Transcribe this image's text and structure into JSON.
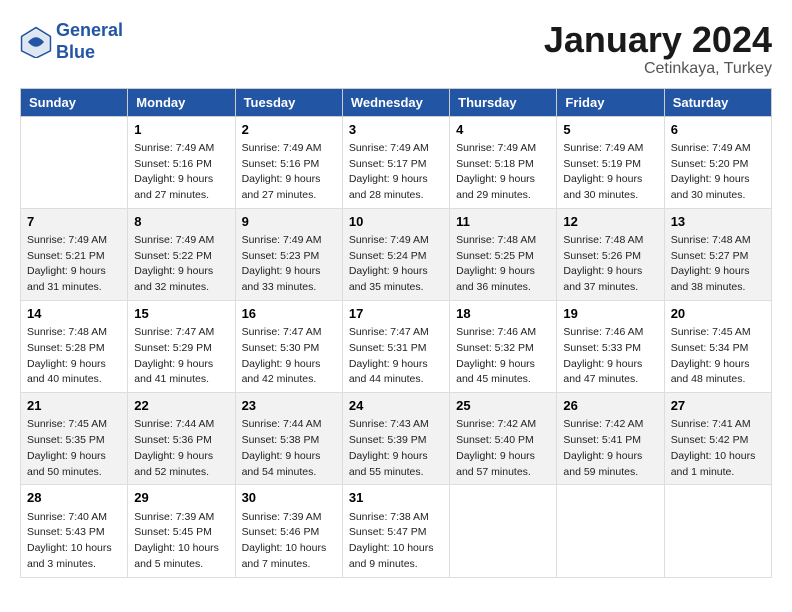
{
  "header": {
    "logo_line1": "General",
    "logo_line2": "Blue",
    "month_title": "January 2024",
    "location": "Cetinkaya, Turkey"
  },
  "days_of_week": [
    "Sunday",
    "Monday",
    "Tuesday",
    "Wednesday",
    "Thursday",
    "Friday",
    "Saturday"
  ],
  "weeks": [
    [
      {
        "day": "",
        "sunrise": "",
        "sunset": "",
        "daylight": ""
      },
      {
        "day": "1",
        "sunrise": "Sunrise: 7:49 AM",
        "sunset": "Sunset: 5:16 PM",
        "daylight": "Daylight: 9 hours and 27 minutes."
      },
      {
        "day": "2",
        "sunrise": "Sunrise: 7:49 AM",
        "sunset": "Sunset: 5:16 PM",
        "daylight": "Daylight: 9 hours and 27 minutes."
      },
      {
        "day": "3",
        "sunrise": "Sunrise: 7:49 AM",
        "sunset": "Sunset: 5:17 PM",
        "daylight": "Daylight: 9 hours and 28 minutes."
      },
      {
        "day": "4",
        "sunrise": "Sunrise: 7:49 AM",
        "sunset": "Sunset: 5:18 PM",
        "daylight": "Daylight: 9 hours and 29 minutes."
      },
      {
        "day": "5",
        "sunrise": "Sunrise: 7:49 AM",
        "sunset": "Sunset: 5:19 PM",
        "daylight": "Daylight: 9 hours and 30 minutes."
      },
      {
        "day": "6",
        "sunrise": "Sunrise: 7:49 AM",
        "sunset": "Sunset: 5:20 PM",
        "daylight": "Daylight: 9 hours and 30 minutes."
      }
    ],
    [
      {
        "day": "7",
        "sunrise": "Sunrise: 7:49 AM",
        "sunset": "Sunset: 5:21 PM",
        "daylight": "Daylight: 9 hours and 31 minutes."
      },
      {
        "day": "8",
        "sunrise": "Sunrise: 7:49 AM",
        "sunset": "Sunset: 5:22 PM",
        "daylight": "Daylight: 9 hours and 32 minutes."
      },
      {
        "day": "9",
        "sunrise": "Sunrise: 7:49 AM",
        "sunset": "Sunset: 5:23 PM",
        "daylight": "Daylight: 9 hours and 33 minutes."
      },
      {
        "day": "10",
        "sunrise": "Sunrise: 7:49 AM",
        "sunset": "Sunset: 5:24 PM",
        "daylight": "Daylight: 9 hours and 35 minutes."
      },
      {
        "day": "11",
        "sunrise": "Sunrise: 7:48 AM",
        "sunset": "Sunset: 5:25 PM",
        "daylight": "Daylight: 9 hours and 36 minutes."
      },
      {
        "day": "12",
        "sunrise": "Sunrise: 7:48 AM",
        "sunset": "Sunset: 5:26 PM",
        "daylight": "Daylight: 9 hours and 37 minutes."
      },
      {
        "day": "13",
        "sunrise": "Sunrise: 7:48 AM",
        "sunset": "Sunset: 5:27 PM",
        "daylight": "Daylight: 9 hours and 38 minutes."
      }
    ],
    [
      {
        "day": "14",
        "sunrise": "Sunrise: 7:48 AM",
        "sunset": "Sunset: 5:28 PM",
        "daylight": "Daylight: 9 hours and 40 minutes."
      },
      {
        "day": "15",
        "sunrise": "Sunrise: 7:47 AM",
        "sunset": "Sunset: 5:29 PM",
        "daylight": "Daylight: 9 hours and 41 minutes."
      },
      {
        "day": "16",
        "sunrise": "Sunrise: 7:47 AM",
        "sunset": "Sunset: 5:30 PM",
        "daylight": "Daylight: 9 hours and 42 minutes."
      },
      {
        "day": "17",
        "sunrise": "Sunrise: 7:47 AM",
        "sunset": "Sunset: 5:31 PM",
        "daylight": "Daylight: 9 hours and 44 minutes."
      },
      {
        "day": "18",
        "sunrise": "Sunrise: 7:46 AM",
        "sunset": "Sunset: 5:32 PM",
        "daylight": "Daylight: 9 hours and 45 minutes."
      },
      {
        "day": "19",
        "sunrise": "Sunrise: 7:46 AM",
        "sunset": "Sunset: 5:33 PM",
        "daylight": "Daylight: 9 hours and 47 minutes."
      },
      {
        "day": "20",
        "sunrise": "Sunrise: 7:45 AM",
        "sunset": "Sunset: 5:34 PM",
        "daylight": "Daylight: 9 hours and 48 minutes."
      }
    ],
    [
      {
        "day": "21",
        "sunrise": "Sunrise: 7:45 AM",
        "sunset": "Sunset: 5:35 PM",
        "daylight": "Daylight: 9 hours and 50 minutes."
      },
      {
        "day": "22",
        "sunrise": "Sunrise: 7:44 AM",
        "sunset": "Sunset: 5:36 PM",
        "daylight": "Daylight: 9 hours and 52 minutes."
      },
      {
        "day": "23",
        "sunrise": "Sunrise: 7:44 AM",
        "sunset": "Sunset: 5:38 PM",
        "daylight": "Daylight: 9 hours and 54 minutes."
      },
      {
        "day": "24",
        "sunrise": "Sunrise: 7:43 AM",
        "sunset": "Sunset: 5:39 PM",
        "daylight": "Daylight: 9 hours and 55 minutes."
      },
      {
        "day": "25",
        "sunrise": "Sunrise: 7:42 AM",
        "sunset": "Sunset: 5:40 PM",
        "daylight": "Daylight: 9 hours and 57 minutes."
      },
      {
        "day": "26",
        "sunrise": "Sunrise: 7:42 AM",
        "sunset": "Sunset: 5:41 PM",
        "daylight": "Daylight: 9 hours and 59 minutes."
      },
      {
        "day": "27",
        "sunrise": "Sunrise: 7:41 AM",
        "sunset": "Sunset: 5:42 PM",
        "daylight": "Daylight: 10 hours and 1 minute."
      }
    ],
    [
      {
        "day": "28",
        "sunrise": "Sunrise: 7:40 AM",
        "sunset": "Sunset: 5:43 PM",
        "daylight": "Daylight: 10 hours and 3 minutes."
      },
      {
        "day": "29",
        "sunrise": "Sunrise: 7:39 AM",
        "sunset": "Sunset: 5:45 PM",
        "daylight": "Daylight: 10 hours and 5 minutes."
      },
      {
        "day": "30",
        "sunrise": "Sunrise: 7:39 AM",
        "sunset": "Sunset: 5:46 PM",
        "daylight": "Daylight: 10 hours and 7 minutes."
      },
      {
        "day": "31",
        "sunrise": "Sunrise: 7:38 AM",
        "sunset": "Sunset: 5:47 PM",
        "daylight": "Daylight: 10 hours and 9 minutes."
      },
      {
        "day": "",
        "sunrise": "",
        "sunset": "",
        "daylight": ""
      },
      {
        "day": "",
        "sunrise": "",
        "sunset": "",
        "daylight": ""
      },
      {
        "day": "",
        "sunrise": "",
        "sunset": "",
        "daylight": ""
      }
    ]
  ]
}
